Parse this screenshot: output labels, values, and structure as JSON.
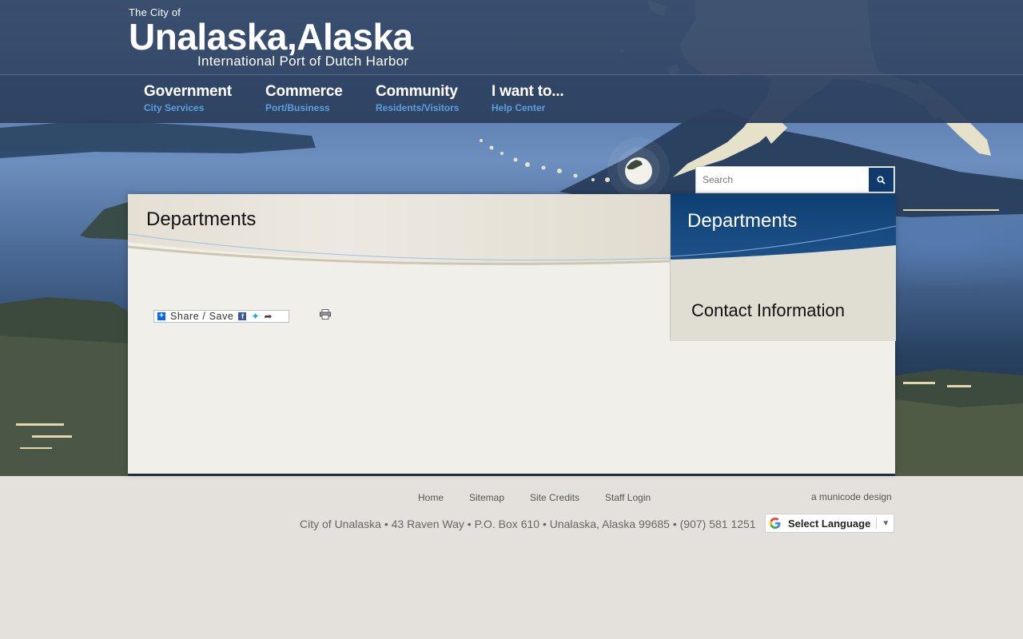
{
  "header": {
    "city_of": "The City of",
    "site_name": "Unalaska,Alaska",
    "tagline": "International Port of Dutch Harbor"
  },
  "nav": [
    {
      "title": "Government",
      "subtitle": "City Services"
    },
    {
      "title": "Commerce",
      "subtitle": "Port/Business"
    },
    {
      "title": "Community",
      "subtitle": "Residents/Visitors"
    },
    {
      "title": "I want to...",
      "subtitle": "Help Center"
    }
  ],
  "search": {
    "placeholder": "Search",
    "button_icon": "search-icon"
  },
  "main": {
    "page_title": "Departments",
    "share_label": "Share / Save",
    "print_icon": "printer-icon"
  },
  "sidebar": {
    "heading": "Departments",
    "items": [
      {
        "label": "Contact Information"
      }
    ]
  },
  "footer": {
    "links": [
      "Home",
      "Sitemap",
      "Site Credits",
      "Staff Login"
    ],
    "credit": "a municode design",
    "address": "City of Unalaska • 43 Raven Way • P.O. Box 610 • Unalaska, Alaska 99685 • (907) 581 1251",
    "language_label": "Select Language"
  },
  "colors": {
    "header_bg": "#3a4e6e",
    "nav_subtitle": "#5b9fdf",
    "sidebar_head": "#0e3f72",
    "search_button": "#0f3a6e",
    "page_bg": "#e4e1dc",
    "content_bg": "#f1efea"
  }
}
